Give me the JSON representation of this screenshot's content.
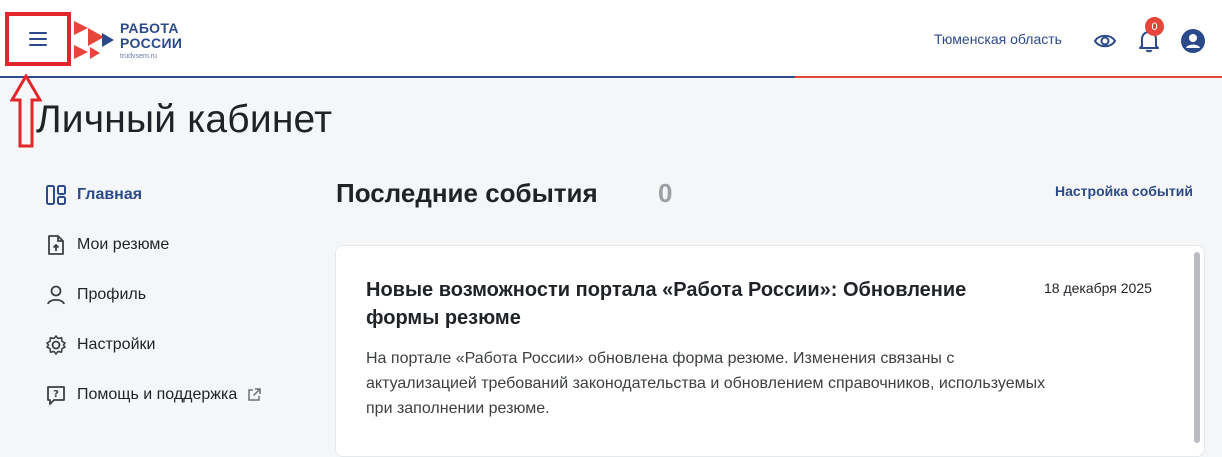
{
  "header": {
    "logo": {
      "name_line1": "РАБОТА",
      "name_line2": "РОССИИ",
      "site": "trudvsem.ru"
    },
    "region": "Тюменская область",
    "notifications_count": "0",
    "icons": {
      "menu": "hamburger-menu-icon",
      "view": "eye-icon",
      "notifications": "bell-icon",
      "profile": "user-avatar-icon"
    },
    "accent_blue": "#2b4a8a",
    "accent_red": "#e6463a"
  },
  "page": {
    "title": "Личный кабинет"
  },
  "sidebar": {
    "items": [
      {
        "label": "Главная",
        "icon": "dashboard-icon",
        "active": true
      },
      {
        "label": "Мои резюме",
        "icon": "document-upload-icon",
        "active": false
      },
      {
        "label": "Профиль",
        "icon": "person-icon",
        "active": false
      },
      {
        "label": "Настройки",
        "icon": "gear-icon",
        "active": false
      },
      {
        "label": "Помощь и поддержка",
        "icon": "help-chat-icon",
        "active": false,
        "external": true
      }
    ]
  },
  "events": {
    "title": "Последние события",
    "count": "0",
    "settings_link": "Настройка событий",
    "items": [
      {
        "title": "Новые возможности портала «Работа России»: Обновление формы резюме",
        "date": "18 декабря 2025",
        "text": "На портале «Работа России» обновлена форма резюме. Изменения связаны с актуализацией требований законодательства и обновлением справочников, используемых при заполнении резюме."
      }
    ]
  }
}
